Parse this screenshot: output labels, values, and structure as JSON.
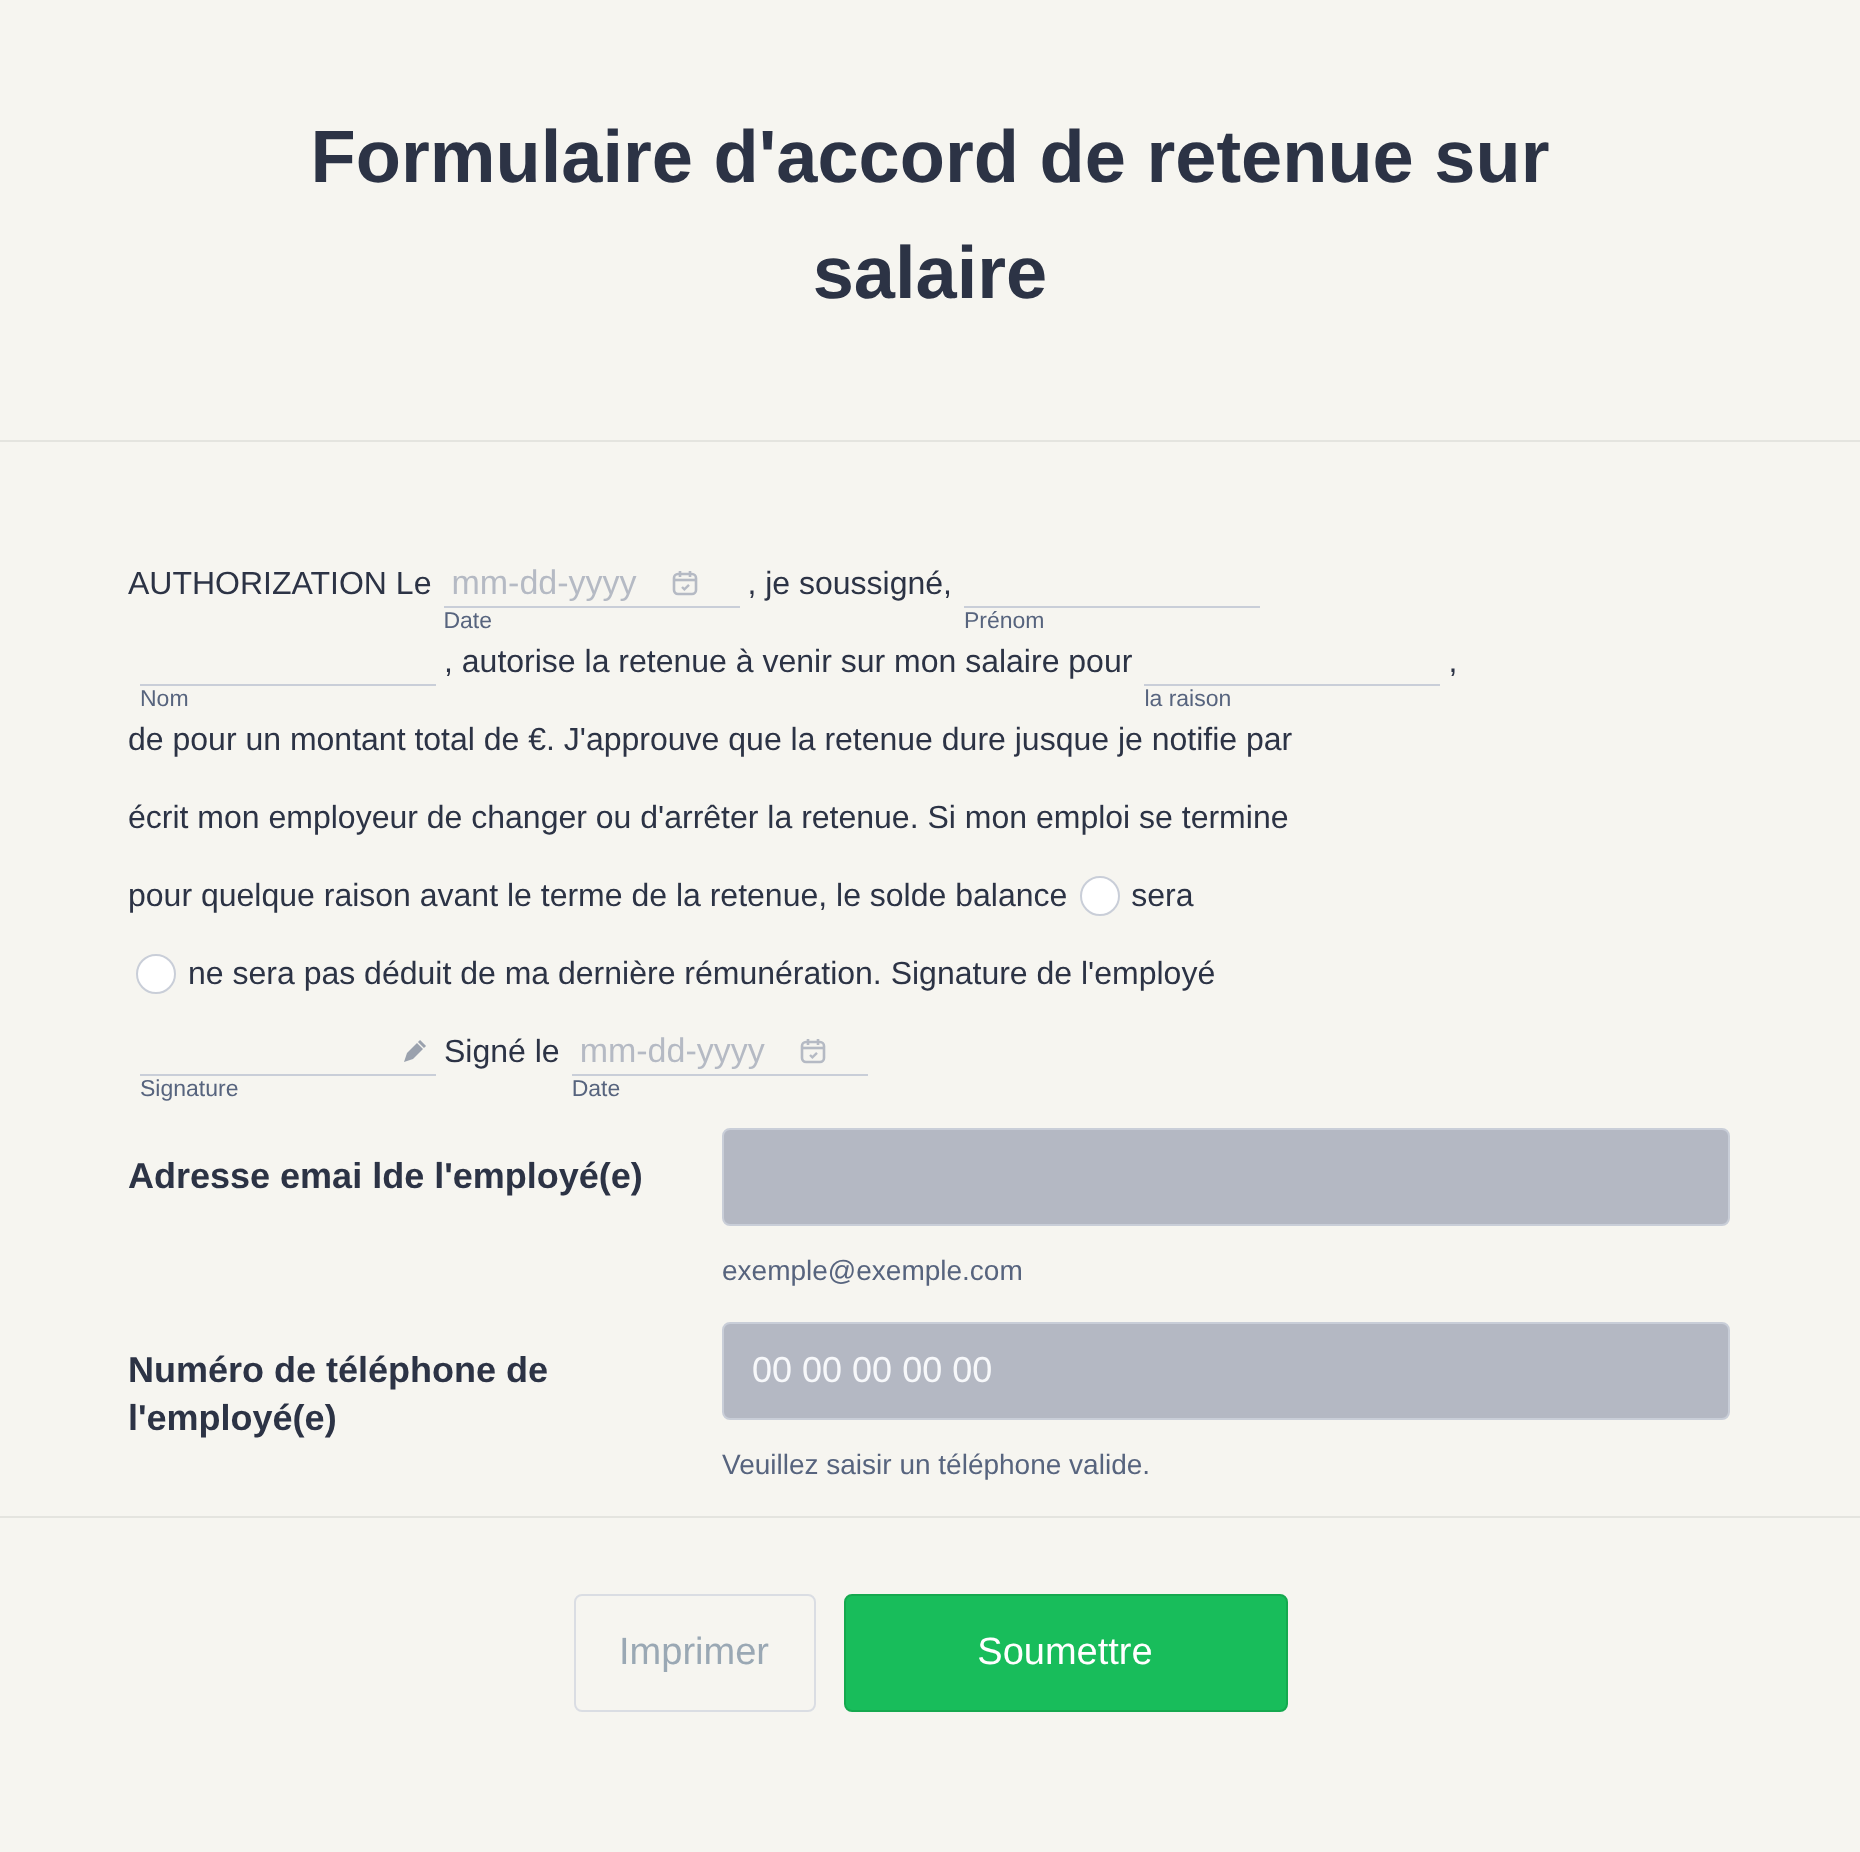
{
  "title": "Formulaire d'accord de retenue sur salaire",
  "paragraph": [
    [
      {
        "kind": "text",
        "text": "AUTHORIZATION Le"
      },
      {
        "kind": "date",
        "placeholder": "mm-dd-yyyy",
        "sublabel": "Date"
      },
      {
        "kind": "text",
        "text": ", je soussigné,"
      },
      {
        "kind": "line",
        "sublabel": "Prénom"
      }
    ],
    [
      {
        "kind": "line",
        "sublabel": "Nom"
      },
      {
        "kind": "text",
        "text": ", autorise la retenue à venir sur mon salaire pour"
      },
      {
        "kind": "line",
        "sublabel": "la raison"
      },
      {
        "kind": "text",
        "text": ","
      }
    ],
    [
      {
        "kind": "text",
        "text": "de pour un montant total de €. J'approuve que la retenue dure jusque je notifie par"
      }
    ],
    [
      {
        "kind": "text",
        "text": "écrit mon employeur de changer ou d'arrêter la retenue. Si mon emploi se termine"
      }
    ],
    [
      {
        "kind": "text",
        "text": "pour quelque raison avant le terme de la retenue, le solde balance"
      },
      {
        "kind": "radio",
        "label": "sera",
        "selected": false
      }
    ],
    [
      {
        "kind": "radio",
        "label": "ne sera pas déduit de ma dernière rémunération. Signature de l'employé",
        "selected": false
      }
    ],
    [
      {
        "kind": "signature",
        "sublabel": "Signature"
      },
      {
        "kind": "text",
        "text": "Signé le"
      },
      {
        "kind": "date",
        "placeholder": "mm-dd-yyyy",
        "sublabel": "Date"
      }
    ]
  ],
  "fields": [
    {
      "label": "Adresse emai lde l'employé(e)",
      "hint": "exemple@exemple.com"
    },
    {
      "label": "Numéro de téléphone de l'employé(e)",
      "placeholder": "00 00 00 00 00",
      "hint": "Veuillez saisir un téléphone valide."
    }
  ],
  "buttons": [
    {
      "label": "Imprimer",
      "kind": "secondary",
      "disabled": true
    },
    {
      "label": "Soumettre",
      "kind": "primary",
      "disabled": false
    }
  ]
}
